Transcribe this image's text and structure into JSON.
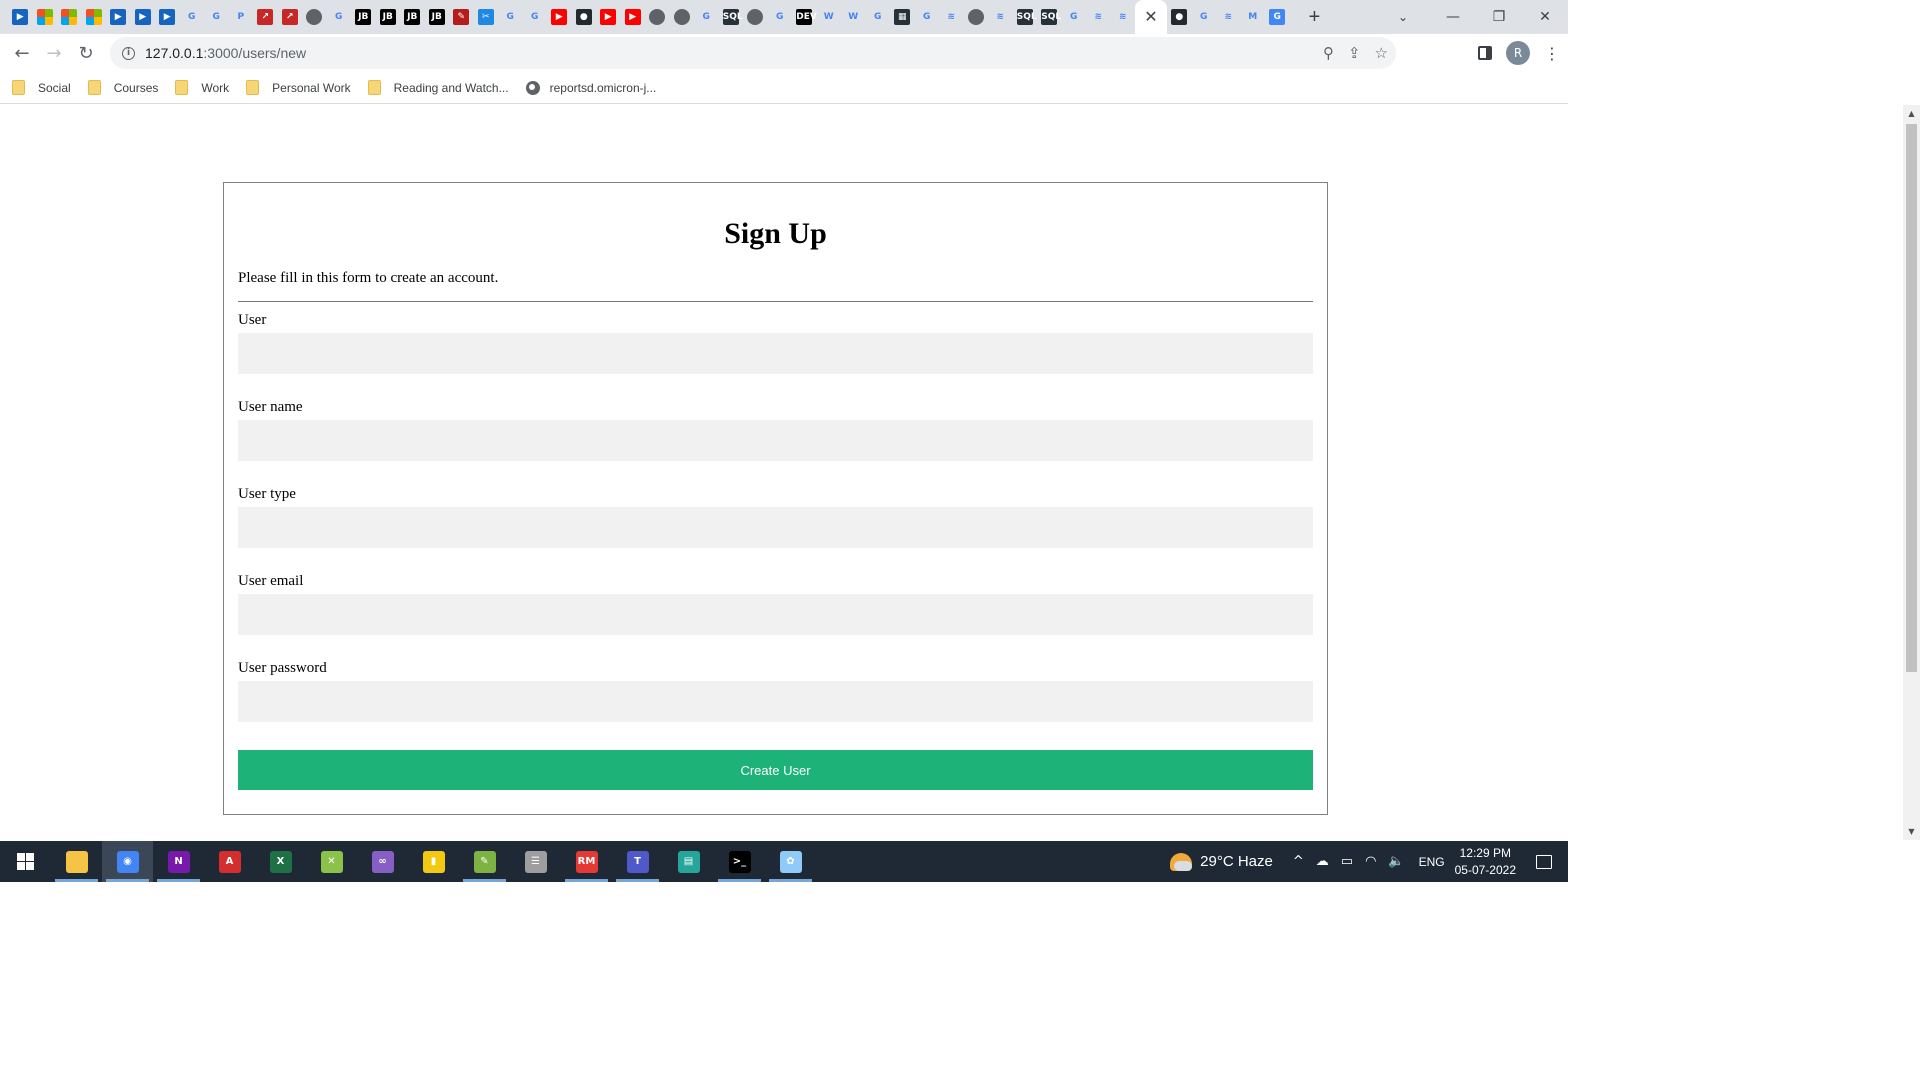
{
  "browser": {
    "favicons": [
      {
        "icon": "youtube-tv-icon",
        "color": "#1565c0",
        "glyph": "▶"
      },
      {
        "icon": "microsoft-icon",
        "color": "#f25022",
        "glyph": ""
      },
      {
        "icon": "microsoft-icon",
        "color": "#f25022",
        "glyph": ""
      },
      {
        "icon": "microsoft-icon",
        "color": "#f25022",
        "glyph": ""
      },
      {
        "icon": "video-icon",
        "color": "#1565c0",
        "glyph": "▶"
      },
      {
        "icon": "video-icon",
        "color": "#1565c0",
        "glyph": "▶"
      },
      {
        "icon": "video-icon",
        "color": "#1565c0",
        "glyph": "▶"
      },
      {
        "icon": "google-icon",
        "color": "#ffffff",
        "glyph": "G"
      },
      {
        "icon": "google-icon",
        "color": "#ffffff",
        "glyph": "G"
      },
      {
        "icon": "ps-icon",
        "color": "#ffffff",
        "glyph": "P"
      },
      {
        "icon": "arrow-icon",
        "color": "#c62828",
        "glyph": "↗"
      },
      {
        "icon": "arrow-icon",
        "color": "#c62828",
        "glyph": "↗"
      },
      {
        "icon": "globe-icon",
        "color": "#5f6368",
        "glyph": ""
      },
      {
        "icon": "google-icon",
        "color": "#ffffff",
        "glyph": "G"
      },
      {
        "icon": "jetbrains-icon",
        "color": "#000000",
        "glyph": "JB"
      },
      {
        "icon": "jetbrains-icon",
        "color": "#000000",
        "glyph": "JB"
      },
      {
        "icon": "jetbrains-icon",
        "color": "#000000",
        "glyph": "JB"
      },
      {
        "icon": "jetbrains-icon",
        "color": "#000000",
        "glyph": "JB"
      },
      {
        "icon": "red-app-icon",
        "color": "#b71c1c",
        "glyph": "✎"
      },
      {
        "icon": "tool-icon",
        "color": "#1e88e5",
        "glyph": "✂"
      },
      {
        "icon": "google-icon",
        "color": "#ffffff",
        "glyph": "G"
      },
      {
        "icon": "google-icon",
        "color": "#ffffff",
        "glyph": "G"
      },
      {
        "icon": "youtube-icon",
        "color": "#ff0000",
        "glyph": "▶"
      },
      {
        "icon": "github-icon",
        "color": "#24292e",
        "glyph": "●"
      },
      {
        "icon": "youtube-icon",
        "color": "#ff0000",
        "glyph": "▶"
      },
      {
        "icon": "youtube-icon",
        "color": "#ff0000",
        "glyph": "▶"
      },
      {
        "icon": "globe-icon",
        "color": "#5f6368",
        "glyph": ""
      },
      {
        "icon": "globe-icon",
        "color": "#5f6368",
        "glyph": ""
      },
      {
        "icon": "google-icon",
        "color": "#ffffff",
        "glyph": "G"
      },
      {
        "icon": "sql-icon",
        "color": "#263238",
        "glyph": "SQL"
      },
      {
        "icon": "globe-icon",
        "color": "#5f6368",
        "glyph": ""
      },
      {
        "icon": "google-icon",
        "color": "#ffffff",
        "glyph": "G"
      },
      {
        "icon": "dev-icon",
        "color": "#000000",
        "glyph": "DEV"
      },
      {
        "icon": "w3-icon",
        "color": "#ffffff",
        "glyph": "W"
      },
      {
        "icon": "w3-icon",
        "color": "#ffffff",
        "glyph": "W"
      },
      {
        "icon": "google-icon",
        "color": "#ffffff",
        "glyph": "G"
      },
      {
        "icon": "sql-icon",
        "color": "#263238",
        "glyph": "▦"
      },
      {
        "icon": "google-icon",
        "color": "#ffffff",
        "glyph": "G"
      },
      {
        "icon": "stack-icon",
        "color": "#ffffff",
        "glyph": "≋"
      },
      {
        "icon": "globe-icon",
        "color": "#5f6368",
        "glyph": ""
      },
      {
        "icon": "stack-icon",
        "color": "#ffffff",
        "glyph": "≋"
      },
      {
        "icon": "sql-icon",
        "color": "#263238",
        "glyph": "SQL"
      },
      {
        "icon": "sql-icon",
        "color": "#263238",
        "glyph": "SQL"
      },
      {
        "icon": "google-icon",
        "color": "#ffffff",
        "glyph": "G"
      },
      {
        "icon": "stack-icon",
        "color": "#ffffff",
        "glyph": "≋"
      },
      {
        "icon": "stack-icon",
        "color": "#ffffff",
        "glyph": "≋"
      }
    ],
    "active_tab_close": "✕",
    "favicons_after": [
      {
        "icon": "github-icon",
        "color": "#24292e",
        "glyph": "●"
      },
      {
        "icon": "google-icon",
        "color": "#ffffff",
        "glyph": "G"
      },
      {
        "icon": "stack-icon",
        "color": "#ffffff",
        "glyph": "≋"
      },
      {
        "icon": "gmail-icon",
        "color": "#ffffff",
        "glyph": "M"
      },
      {
        "icon": "translate-icon",
        "color": "#4285f4",
        "glyph": "G"
      }
    ],
    "new_tab": "+",
    "tab_search": "⌄",
    "window_controls": {
      "minimize": "—",
      "restore": "❐",
      "close": "✕"
    },
    "nav": {
      "back": "←",
      "forward": "→",
      "reload": "↻"
    },
    "url_host": "127.0.0.1",
    "url_path": ":3000/users/new",
    "omnibox_icons": {
      "zoom": "⚲",
      "share": "⇪",
      "bookmark": "☆"
    },
    "profile_initial": "R",
    "menu": "⋮",
    "bookmarks": [
      {
        "type": "folder",
        "label": "Social"
      },
      {
        "type": "folder",
        "label": "Courses"
      },
      {
        "type": "folder",
        "label": "Work"
      },
      {
        "type": "folder",
        "label": "Personal Work"
      },
      {
        "type": "folder",
        "label": "Reading and Watch..."
      },
      {
        "type": "globe",
        "label": "reportsd.omicron-j..."
      }
    ]
  },
  "form": {
    "title": "Sign Up",
    "description": "Please fill in this form to create an account.",
    "fields": [
      {
        "label": "User",
        "value": "",
        "placeholder": ""
      },
      {
        "label": "User name",
        "value": "",
        "placeholder": ""
      },
      {
        "label": "User type",
        "value": "",
        "placeholder": ""
      },
      {
        "label": "User email",
        "value": "",
        "placeholder": ""
      },
      {
        "label": "User password",
        "value": "",
        "placeholder": ""
      }
    ],
    "submit_label": "Create User",
    "accent_color": "#1db277"
  },
  "scrollbar": {
    "up": "▲",
    "down": "▼"
  },
  "taskbar": {
    "apps": [
      {
        "icon": "file-explorer-icon",
        "color": "#f6c445",
        "glyph": "",
        "running": true,
        "active": false
      },
      {
        "icon": "chrome-icon",
        "color": "#4285f4",
        "glyph": "◉",
        "running": true,
        "active": true
      },
      {
        "icon": "onenote-icon",
        "color": "#7719aa",
        "glyph": "N",
        "running": true,
        "active": false
      },
      {
        "icon": "acrobat-icon",
        "color": "#d32f2f",
        "glyph": "A",
        "running": false,
        "active": false
      },
      {
        "icon": "excel-icon",
        "color": "#1e7145",
        "glyph": "X",
        "running": false,
        "active": false
      },
      {
        "icon": "app-icon",
        "color": "#8bc34a",
        "glyph": "✕",
        "running": false,
        "active": false
      },
      {
        "icon": "visual-studio-icon",
        "color": "#865fc5",
        "glyph": "∞",
        "running": false,
        "active": false
      },
      {
        "icon": "power-bi-icon",
        "color": "#f2c811",
        "glyph": "▮",
        "running": false,
        "active": false
      },
      {
        "icon": "notepad-icon",
        "color": "#7cb342",
        "glyph": "✎",
        "running": true,
        "active": false
      },
      {
        "icon": "database-icon",
        "color": "#9e9e9e",
        "glyph": "☰",
        "running": false,
        "active": false
      },
      {
        "icon": "rubymine-icon",
        "color": "#e53935",
        "glyph": "RM",
        "running": true,
        "active": false
      },
      {
        "icon": "teams-icon",
        "color": "#5059c9",
        "glyph": "T",
        "running": true,
        "active": false
      },
      {
        "icon": "app-window-icon",
        "color": "#26a69a",
        "glyph": "▤",
        "running": false,
        "active": false
      },
      {
        "icon": "terminal-icon",
        "color": "#000000",
        "glyph": ">_",
        "running": true,
        "active": false
      },
      {
        "icon": "paint-icon",
        "color": "#90caf9",
        "glyph": "✿",
        "running": true,
        "active": false
      }
    ],
    "weather": "29°C  Haze",
    "tray_icons": {
      "chevron": "^",
      "cloud": "☁",
      "battery": "▭",
      "wifi": "◠",
      "volume": "🔈"
    },
    "language": "ENG",
    "time": "12:29 PM",
    "date": "05-07-2022"
  }
}
